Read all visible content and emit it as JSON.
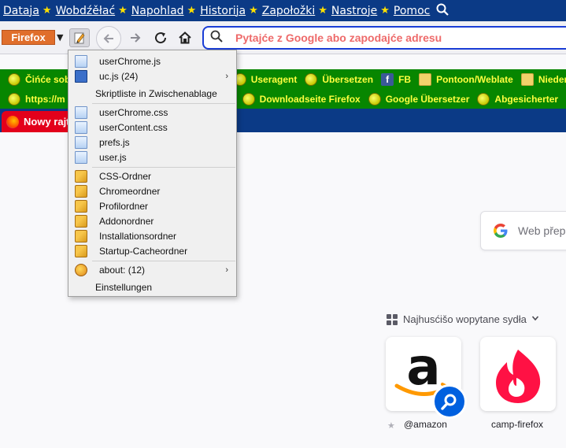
{
  "menubar": {
    "items": [
      {
        "label": "Dataja"
      },
      {
        "label": "Wobdźěłać"
      },
      {
        "label": "Napohlad"
      },
      {
        "label": "Historija"
      },
      {
        "label": "Zapołožki"
      },
      {
        "label": "Nastroje"
      },
      {
        "label": "Pomoc"
      }
    ],
    "search_icon": "magnifier-icon"
  },
  "navbar": {
    "firefox_button": "Firefox",
    "urlbar_placeholder": "Pytajće z Google abo zapodajće adresu"
  },
  "bookmarks_row1": [
    {
      "label": "Čińće sobu",
      "icon": "globe"
    },
    {
      "label": "",
      "icon": "globe"
    },
    {
      "label": "Useragent",
      "icon": "globe"
    },
    {
      "label": "Übersetzen",
      "icon": "globe"
    },
    {
      "label": "FB",
      "icon": "facebook"
    },
    {
      "label": "Pontoon/Weblate",
      "icon": "folder"
    },
    {
      "label": "Niedersorbisch",
      "icon": "folder"
    }
  ],
  "bookmarks_row2": [
    {
      "label": "https://m",
      "icon": "globe"
    },
    {
      "label": "Downloadseite Firefox",
      "icon": "globe"
    },
    {
      "label": "Google Übersetzer",
      "icon": "globe"
    },
    {
      "label": "Abgesicherter",
      "icon": "globe"
    }
  ],
  "tab": {
    "title": "Nowy rajt"
  },
  "popup_menu": {
    "items": [
      {
        "label": "userChrome.js",
        "icon": "file",
        "submenu": false
      },
      {
        "label": "uc.js (24)",
        "icon": "computer",
        "submenu": true
      },
      {
        "label": "Skriptliste in Zwischenablage",
        "icon": "",
        "submenu": false
      },
      {
        "label": "userChrome.css",
        "icon": "file",
        "submenu": false
      },
      {
        "label": "userContent.css",
        "icon": "file",
        "submenu": false
      },
      {
        "label": "prefs.js",
        "icon": "file",
        "submenu": false
      },
      {
        "label": "user.js",
        "icon": "file",
        "submenu": false
      },
      {
        "label": "CSS-Ordner",
        "icon": "folder",
        "submenu": false
      },
      {
        "label": "Chromeordner",
        "icon": "folder",
        "submenu": false
      },
      {
        "label": "Profilordner",
        "icon": "folder",
        "submenu": false
      },
      {
        "label": "Addonordner",
        "icon": "folder",
        "submenu": false
      },
      {
        "label": "Installationsordner",
        "icon": "folder",
        "submenu": false
      },
      {
        "label": "Startup-Cacheordner",
        "icon": "folder",
        "submenu": false
      },
      {
        "label": "about: (12)",
        "icon": "about",
        "submenu": true
      },
      {
        "label": "Einstellungen",
        "icon": "",
        "submenu": false
      }
    ]
  },
  "newtab": {
    "search_placeholder": "Web přep",
    "topsites_header": "Najhusćišo wopytane sydła",
    "tiles": [
      {
        "label": "@amazon"
      },
      {
        "label": "camp-firefox"
      }
    ]
  },
  "colors": {
    "menubar_bg": "#0b3a86",
    "bookmarks_bg": "#078600",
    "bookmark_text": "#ffff40",
    "firefox_button": "#e06e2b",
    "tab_active": "#e3001b",
    "url_placeholder": "#ee6a6a"
  }
}
